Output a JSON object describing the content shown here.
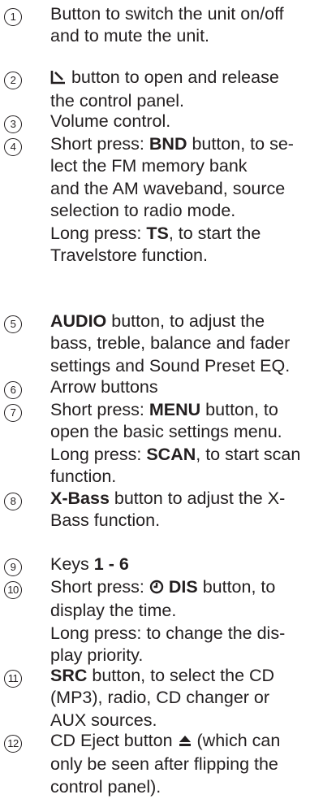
{
  "items": [
    {
      "num": "1",
      "lines": [
        {
          "text": "Button to switch the unit on/off"
        },
        {
          "text": "and to mute the unit."
        }
      ]
    },
    {
      "num": "2",
      "lines": [
        {
          "icon": "panel-release-icon",
          "text": " button to open and release"
        },
        {
          "text": "the control panel."
        }
      ]
    },
    {
      "num": "3",
      "lines": [
        {
          "text": "Volume control."
        }
      ]
    },
    {
      "num": "4",
      "lines": [
        {
          "pre": "Short press: ",
          "bold": "BND",
          "post": " button, to se-"
        },
        {
          "text": "lect the FM memory bank"
        },
        {
          "text": "and the AM waveband, source"
        },
        {
          "text": "selection to radio mode."
        },
        {
          "pre": "Long press: ",
          "bold": "TS",
          "post": ", to start the"
        },
        {
          "text": "Travelstore function."
        }
      ]
    },
    {
      "num": "5",
      "lines": [
        {
          "bold": "AUDIO",
          "post": " button, to adjust the"
        },
        {
          "text": "bass, treble, balance and fader"
        },
        {
          "text": "settings and Sound Preset EQ."
        }
      ]
    },
    {
      "num": "6",
      "lines": [
        {
          "text": "Arrow buttons"
        }
      ]
    },
    {
      "num": "7",
      "lines": [
        {
          "pre": "Short press: ",
          "bold": "MENU",
          "post": " button, to"
        },
        {
          "text": "open the basic settings menu."
        },
        {
          "pre": "Long press: ",
          "bold": "SCAN",
          "post": ", to start scan"
        },
        {
          "text": "function."
        }
      ]
    },
    {
      "num": "8",
      "lines": [
        {
          "bold": "X-Bass",
          "post": " button to adjust the X-"
        },
        {
          "text": "Bass function."
        }
      ]
    },
    {
      "num": "9",
      "lines": [
        {
          "pre": "Keys ",
          "bold": "1 - 6"
        }
      ]
    },
    {
      "num": "10",
      "lines": [
        {
          "pre": "Short press: ",
          "icon": "clock-icon",
          "bold": " DIS",
          "post": " button, to"
        },
        {
          "text": "display the time."
        },
        {
          "text": "Long press: to change the dis-"
        },
        {
          "text": "play priority."
        }
      ]
    },
    {
      "num": "11",
      "lines": [
        {
          "bold": "SRC",
          "post": " button, to select the CD"
        },
        {
          "text": "(MP3), radio, CD changer or"
        },
        {
          "text": "AUX sources."
        }
      ]
    },
    {
      "num": "12",
      "lines": [
        {
          "pre": "CD Eject button ",
          "icon": "eject-icon",
          "post": " (which can"
        },
        {
          "text": "only be seen after flipping the"
        },
        {
          "text": "control panel)."
        }
      ]
    }
  ]
}
